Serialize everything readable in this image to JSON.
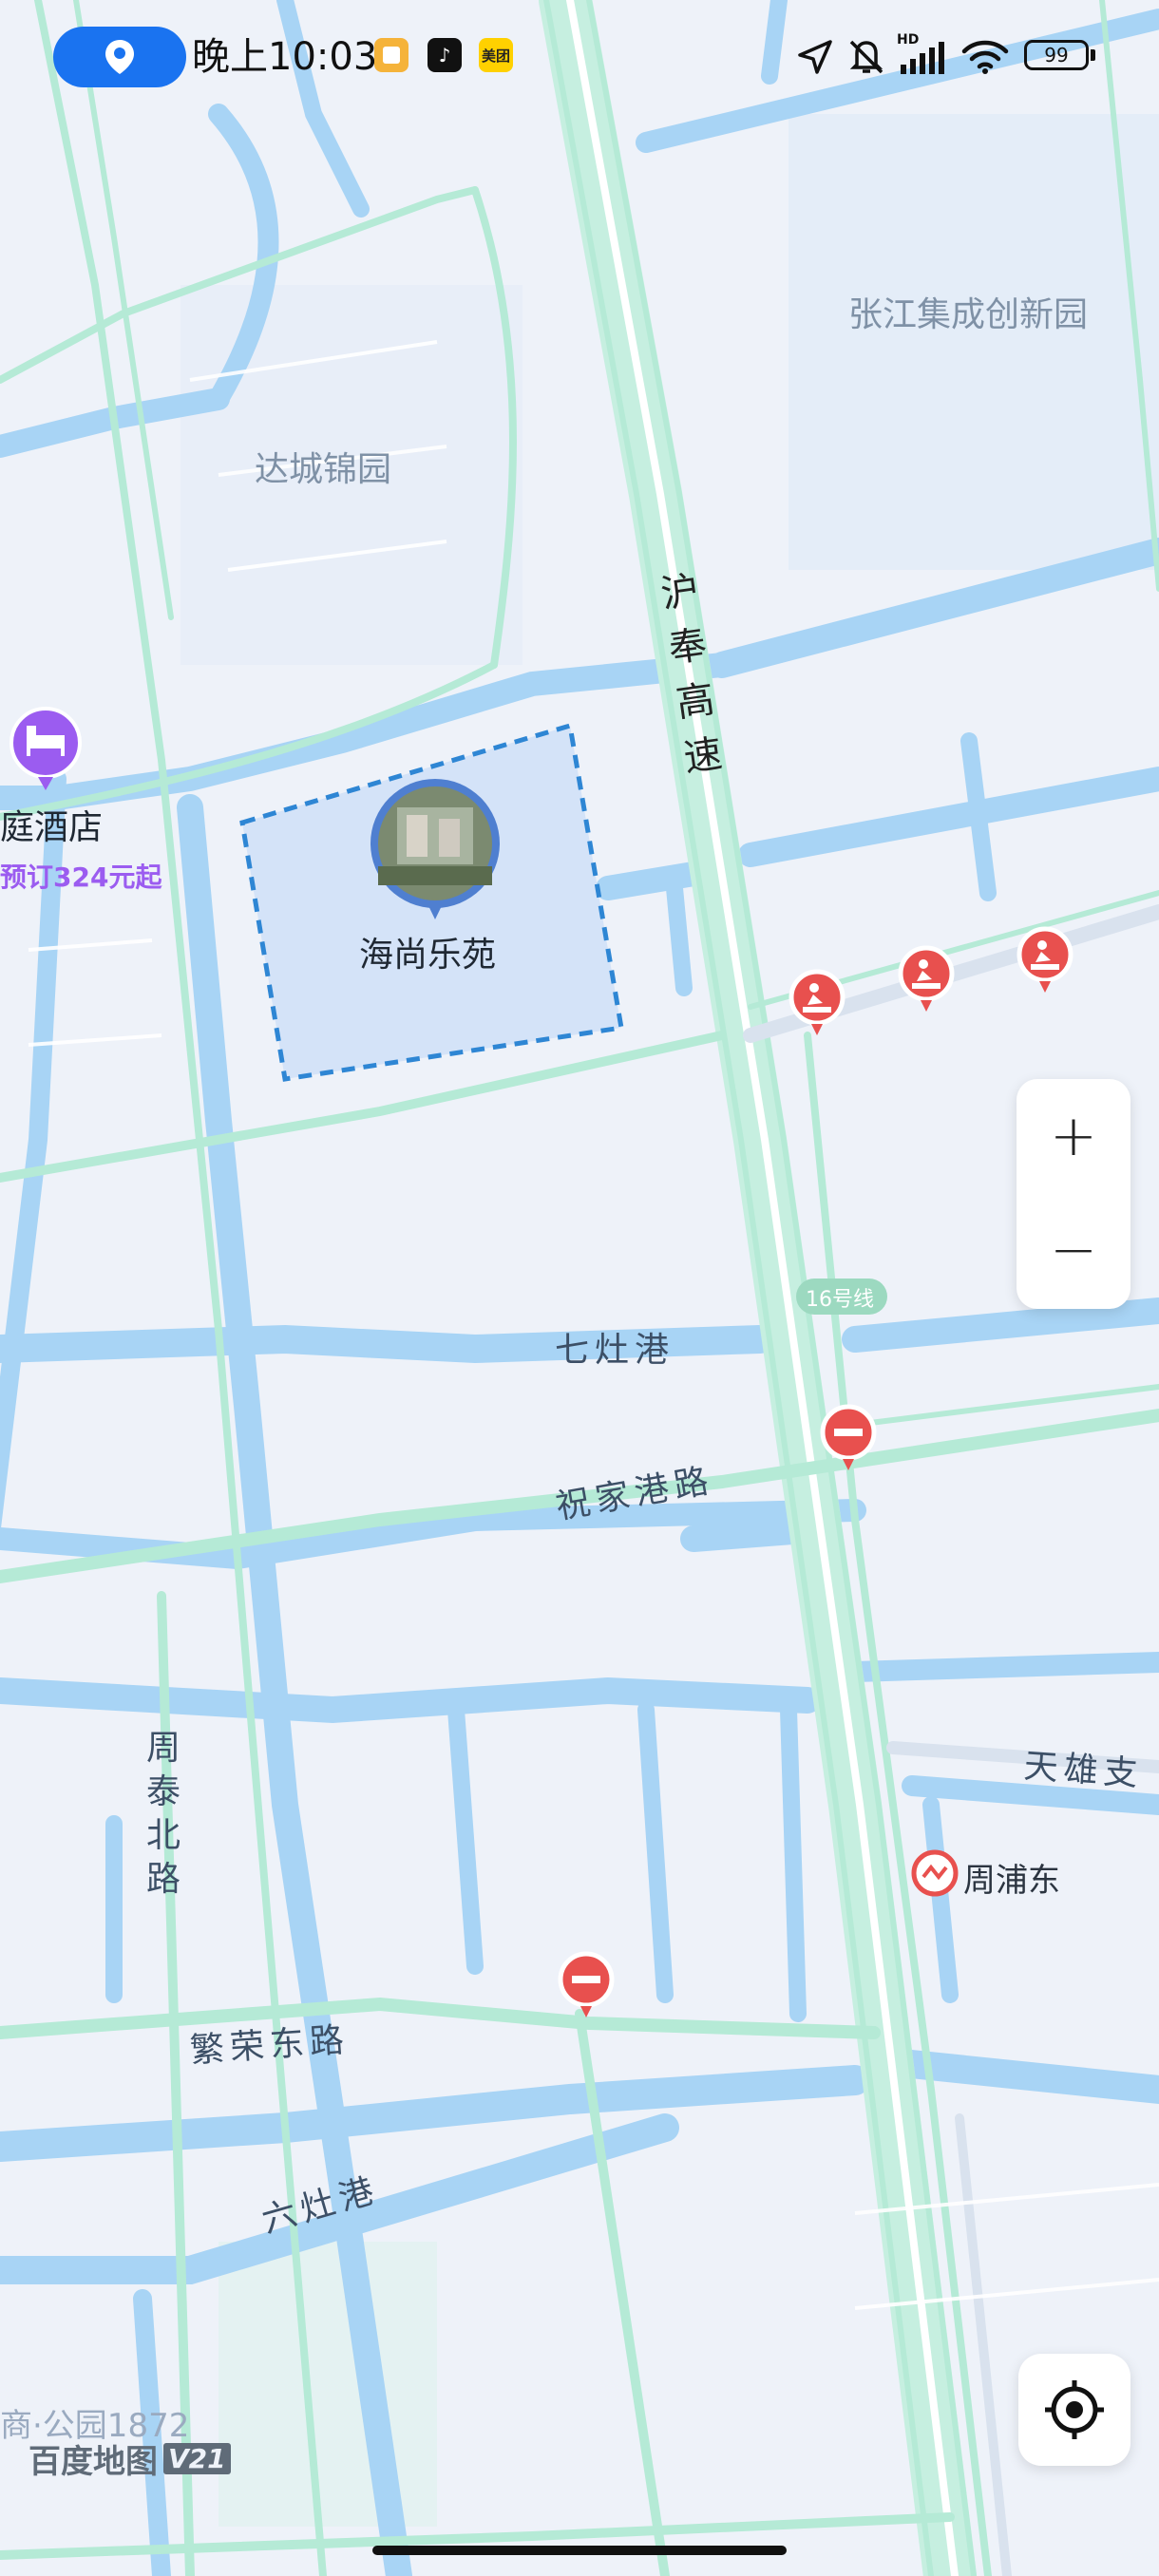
{
  "status_bar": {
    "time": "晚上10:03",
    "battery": "99",
    "network_badge": "HD",
    "app_icons": [
      "notes-app-icon",
      "tiktok-app-icon",
      "meituan-app-icon"
    ],
    "meituan_label": "美团",
    "icons": [
      "location-arrow-icon",
      "mute-bell-icon",
      "signal-icon",
      "wifi-icon",
      "battery-icon"
    ]
  },
  "map": {
    "area_labels": {
      "zhangjiang": "张江集成创新园",
      "dacheng": "达城锦园"
    },
    "road_labels": {
      "expressway": "沪奉高速",
      "qizaogang": "七灶港",
      "zhujiagang": "祝家港路",
      "zhoutai": "周泰北路",
      "fanrong": "繁荣东路",
      "liuzaogang": "六灶港",
      "tianxiong": "天雄支"
    },
    "metro": {
      "line_badge": "16号线",
      "station": "周浦东"
    },
    "hotel": {
      "name": "庭酒店",
      "price": "预订324元起"
    },
    "poi": {
      "name": "海尚乐苑"
    },
    "watermark": {
      "partial_place": "商·公园1872",
      "logo": "百度地图",
      "version": "V21"
    }
  },
  "controls": {
    "zoom_in": "+",
    "zoom_out": "−"
  },
  "colors": {
    "land": "#eef2f9",
    "water": "#a8d4f5",
    "road": "#b5ead6",
    "accent": "#1a73f0",
    "hotel_marker": "#9b5cf0",
    "alert_marker": "#e8504e"
  }
}
